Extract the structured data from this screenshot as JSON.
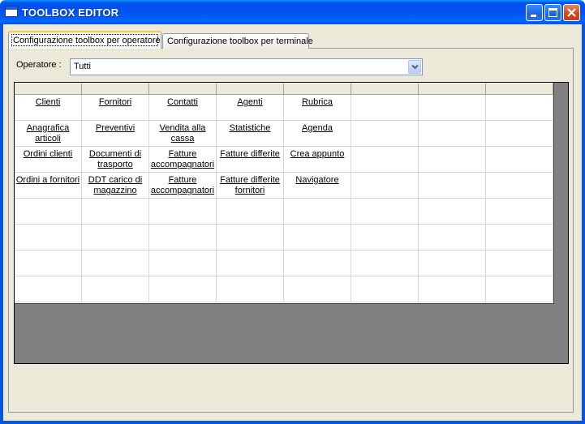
{
  "window": {
    "title": "TOOLBOX EDITOR"
  },
  "tabs": [
    {
      "label": "Configurazione toolbox per operatore"
    },
    {
      "label": "Configurazione toolbox per terminale"
    }
  ],
  "operator": {
    "label": "Operatore :",
    "value": "Tutti"
  },
  "grid": {
    "rows": [
      [
        "Clienti",
        "Fornitori",
        "Contatti",
        "Agenti",
        "Rubrica",
        "",
        "",
        ""
      ],
      [
        "Anagrafica articoli",
        "Preventivi",
        "Vendita alla cassa",
        "Statistiche",
        "Agenda",
        "",
        "",
        ""
      ],
      [
        "Ordini clienti",
        "Documenti di trasporto",
        "Fatture accompagnatori",
        "Fatture differite",
        "Crea appunto",
        "",
        "",
        ""
      ],
      [
        "Ordini a fornitori",
        "DDT carico di magazzino",
        "Fatture accompagnatori",
        "Fatture differite fornitori",
        "Navigatore",
        "",
        "",
        ""
      ],
      [
        "",
        "",
        "",
        "",
        "",
        "",
        "",
        ""
      ],
      [
        "",
        "",
        "",
        "",
        "",
        "",
        "",
        ""
      ],
      [
        "",
        "",
        "",
        "",
        "",
        "",
        "",
        ""
      ],
      [
        "",
        "",
        "",
        "",
        "",
        "",
        "",
        ""
      ]
    ]
  }
}
